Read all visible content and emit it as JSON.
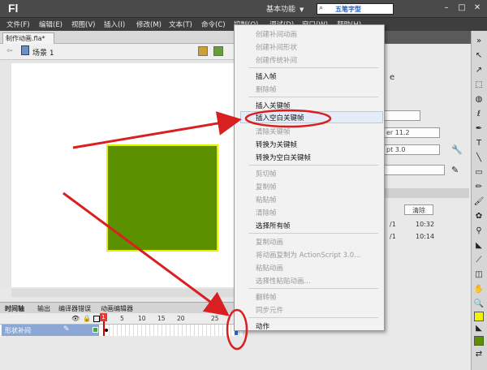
{
  "app": {
    "logo": "Fl",
    "workspace": "基本功能",
    "search_text": "五笔字型"
  },
  "window_buttons": [
    "–",
    "□",
    "✕"
  ],
  "menubar": [
    "文件(F)",
    "编辑(E)",
    "视图(V)",
    "插入(I)",
    "修改(M)",
    "文本(T)",
    "命令(C)",
    "控制(O)",
    "调试(D)",
    "窗口(W)",
    "帮助(H)"
  ],
  "document": {
    "tab": "制作动画.fla*",
    "scene": "场景 1"
  },
  "timeline": {
    "tabs": [
      "时间轴",
      "输出",
      "编译器错误",
      "动画编辑器"
    ],
    "ruler": [
      "1",
      "5",
      "10",
      "15",
      "20",
      "25"
    ],
    "layer_name": "形状补间"
  },
  "context_menu": {
    "items": [
      {
        "label": "创建补间动画",
        "enabled": false
      },
      {
        "label": "创建补间形状",
        "enabled": false
      },
      {
        "label": "创建传统补间",
        "enabled": false
      },
      {
        "label": "插入帧",
        "enabled": true
      },
      {
        "label": "删除帧",
        "enabled": false
      },
      {
        "label": "插入关键帧",
        "enabled": true
      },
      {
        "label": "插入空白关键帧",
        "enabled": true,
        "highlighted": true
      },
      {
        "label": "清除关键帧",
        "enabled": false
      },
      {
        "label": "转换为关键帧",
        "enabled": true
      },
      {
        "label": "转换为空白关键帧",
        "enabled": true
      },
      {
        "label": "剪切帧",
        "enabled": false
      },
      {
        "label": "复制帧",
        "enabled": false
      },
      {
        "label": "粘贴帧",
        "enabled": false
      },
      {
        "label": "清除帧",
        "enabled": false
      },
      {
        "label": "选择所有帧",
        "enabled": true
      },
      {
        "label": "复制动画",
        "enabled": false
      },
      {
        "label": "将动画复制为 ActionScript 3.0...",
        "enabled": false
      },
      {
        "label": "粘贴动画",
        "enabled": false
      },
      {
        "label": "选择性粘贴动画...",
        "enabled": false
      },
      {
        "label": "翻转帧",
        "enabled": false
      },
      {
        "label": "同步元件",
        "enabled": false
      },
      {
        "label": "动作",
        "enabled": true
      }
    ]
  },
  "right_panel": {
    "player": "er 11.2",
    "script": "pt 3.0",
    "clear_button": "清除",
    "history_rows": [
      {
        "a": "/1",
        "time": "10:32"
      },
      {
        "a": "/1",
        "time": "10:14"
      }
    ],
    "letter": "e"
  },
  "colors": {
    "square_fill": "#5b9100",
    "square_stroke": "#e8f000",
    "annotation": "#d92020"
  }
}
